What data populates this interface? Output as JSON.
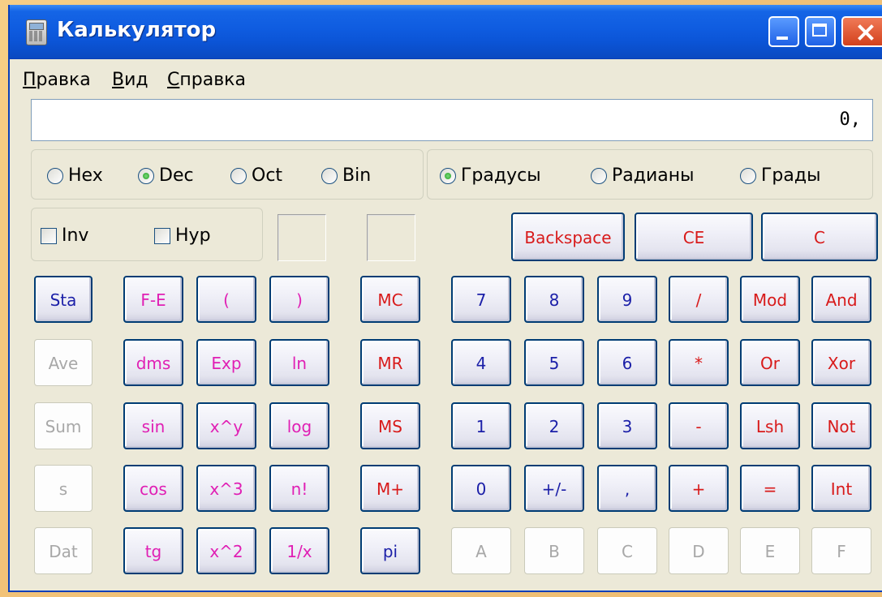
{
  "window": {
    "title": "Калькулятор"
  },
  "menu": [
    {
      "u": "П",
      "rest": "равка"
    },
    {
      "u": "В",
      "rest": "ид"
    },
    {
      "u": "С",
      "rest": "правка"
    }
  ],
  "display": {
    "value": "0,"
  },
  "base_modes": [
    "Hex",
    "Dec",
    "Oct",
    "Bin"
  ],
  "base_selected": "Dec",
  "angle_modes": [
    "Градусы",
    "Радианы",
    "Грады"
  ],
  "angle_selected": "Градусы",
  "checkboxes": {
    "inv": "Inv",
    "hyp": "Hyp"
  },
  "colors": {
    "blue": "#1b1fa8",
    "red": "#d81a1a",
    "magenta": "#e01fb4",
    "gray": "#a8a8a8"
  },
  "top_buttons": {
    "backspace": "Backspace",
    "ce": "CE",
    "c": "C"
  },
  "stat_buttons": [
    "Sta",
    "Ave",
    "Sum",
    "s",
    "Dat"
  ],
  "sci_rows": [
    [
      "F-E",
      "(",
      ")"
    ],
    [
      "dms",
      "Exp",
      "ln"
    ],
    [
      "sin",
      "x^y",
      "log"
    ],
    [
      "cos",
      "x^3",
      "n!"
    ],
    [
      "tg",
      "x^2",
      "1/x"
    ]
  ],
  "mem_buttons": [
    "MC",
    "MR",
    "MS",
    "M+",
    "pi"
  ],
  "num_rows": [
    [
      "7",
      "8",
      "9",
      "/",
      "Mod",
      "And"
    ],
    [
      "4",
      "5",
      "6",
      "*",
      "Or",
      "Xor"
    ],
    [
      "1",
      "2",
      "3",
      "-",
      "Lsh",
      "Not"
    ],
    [
      "0",
      "+/-",
      ",",
      "+",
      "=",
      "Int"
    ],
    [
      "A",
      "B",
      "C",
      "D",
      "E",
      "F"
    ]
  ]
}
